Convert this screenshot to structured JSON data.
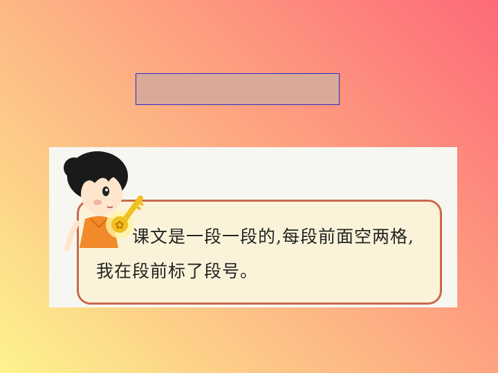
{
  "slide": {
    "title_box": "",
    "speech": {
      "line1": "课文是一段一段的,每段前面空两格,",
      "line2": "我在段前标了段号。"
    }
  }
}
